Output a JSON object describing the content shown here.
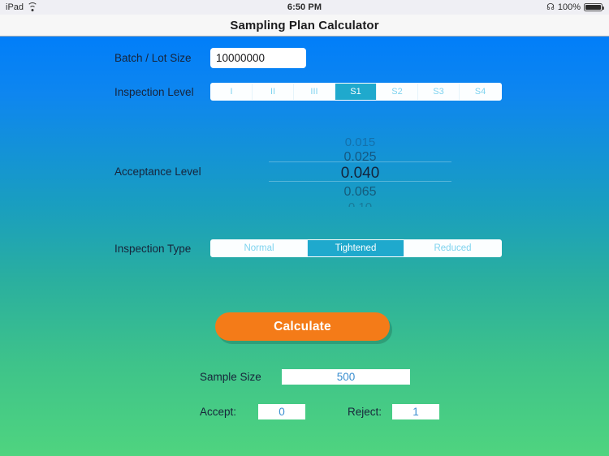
{
  "status_bar": {
    "device": "iPad",
    "wifi_icon": "wifi-icon",
    "time": "6:50 PM",
    "bluetooth_icon": "bluetooth-icon",
    "battery_percent": "100%",
    "battery_icon": "battery-full-icon"
  },
  "navbar": {
    "title": "Sampling Plan Calculator"
  },
  "form": {
    "batch": {
      "label": "Batch / Lot Size",
      "value": "10000000",
      "placeholder": "Batch / Lot Size"
    },
    "inspection_level": {
      "label": "Inspection Level",
      "options": [
        "I",
        "II",
        "III",
        "S1",
        "S2",
        "S3",
        "S4"
      ],
      "selected": "S1"
    },
    "acceptance_level": {
      "label": "Acceptance Level",
      "visible_options": [
        "0.015",
        "0.025",
        "0.040",
        "0.065",
        "0.10"
      ],
      "selected": "0.040"
    },
    "inspection_type": {
      "label": "Inspection Type",
      "options": [
        "Normal",
        "Tightened",
        "Reduced"
      ],
      "selected": "Tightened"
    }
  },
  "actions": {
    "calculate_label": "Calculate"
  },
  "results": {
    "sample_size": {
      "label": "Sample Size",
      "value": "500"
    },
    "accept": {
      "label": "Accept:",
      "value": "0"
    },
    "reject": {
      "label": "Reject:",
      "value": "1"
    }
  },
  "colors": {
    "gradient_top": "#017ef9",
    "gradient_bottom": "#4fd47f",
    "segment_selected": "#1fa9cd",
    "button_orange": "#f47b18",
    "result_text": "#3a8ed0"
  }
}
